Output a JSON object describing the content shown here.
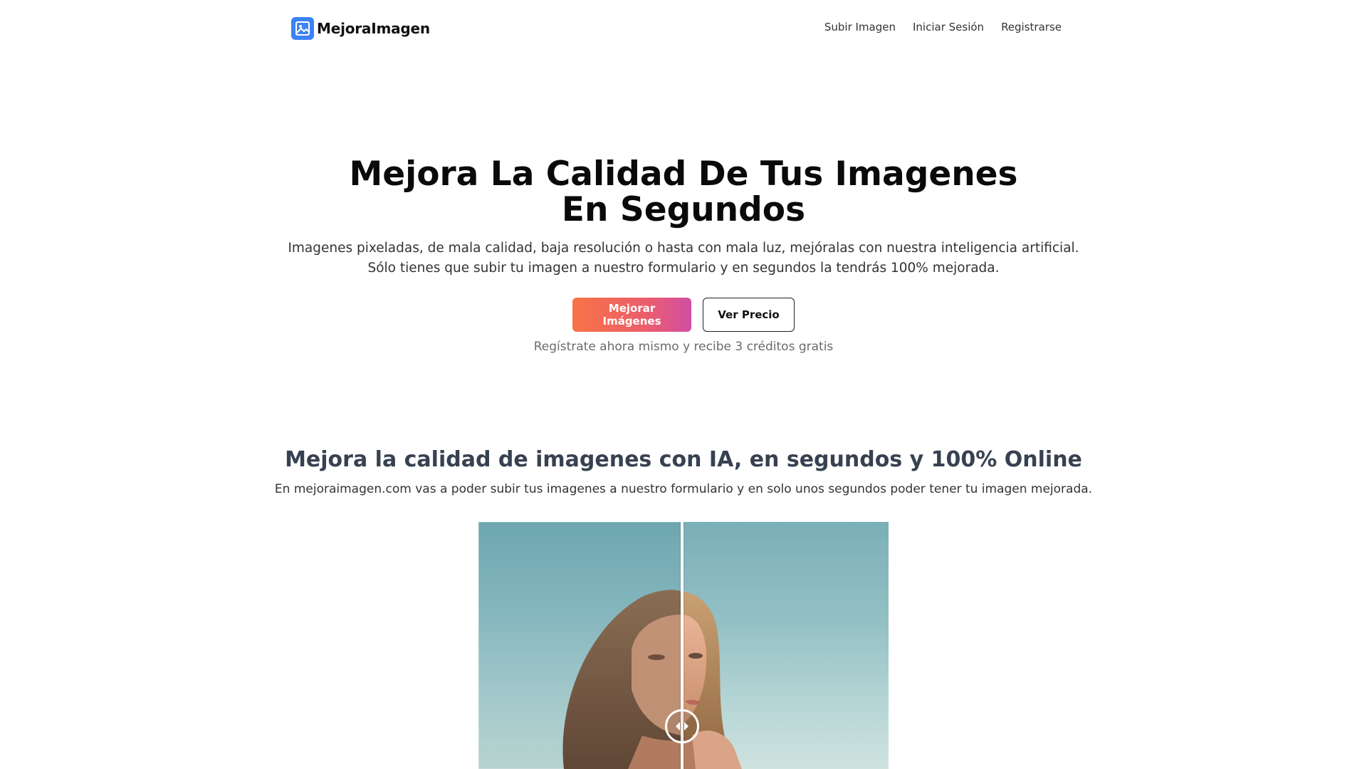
{
  "header": {
    "logo_text": "MejoraImagen",
    "logo_icon": "image-icon",
    "nav": [
      {
        "label": "Subir Imagen"
      },
      {
        "label": "Iniciar Sesión"
      },
      {
        "label": "Registrarse"
      }
    ]
  },
  "hero": {
    "title_line1": "Mejora La Calidad De Tus Imagenes",
    "title_line2": "En Segundos",
    "description": "Imagenes pixeladas, de mala calidad, baja resolución o hasta con mala luz, mejóralas con nuestra inteligencia artificial. Sólo tienes que subir tu imagen a nuestro formulario y en segundos la tendrás 100% mejorada.",
    "primary_button": "Mejorar Imágenes",
    "secondary_button": "Ver Precio",
    "note": "Regístrate ahora mismo y recibe 3 créditos gratis"
  },
  "section": {
    "title": "Mejora la calidad de imagenes con IA, en segundos y 100% Online",
    "description": "En mejoraimagen.com vas a poder subir tus imagenes a nuestro formulario y en solo unos segundos poder tener tu imagen mejorada."
  },
  "comparison": {
    "handle_icon": "left-right-arrows-icon",
    "slider_position": 0.5
  },
  "colors": {
    "logo_bg": "#3b82f6",
    "primary_gradient_start": "#f97346",
    "primary_gradient_end": "#d04fa3",
    "section_title": "#374151"
  }
}
